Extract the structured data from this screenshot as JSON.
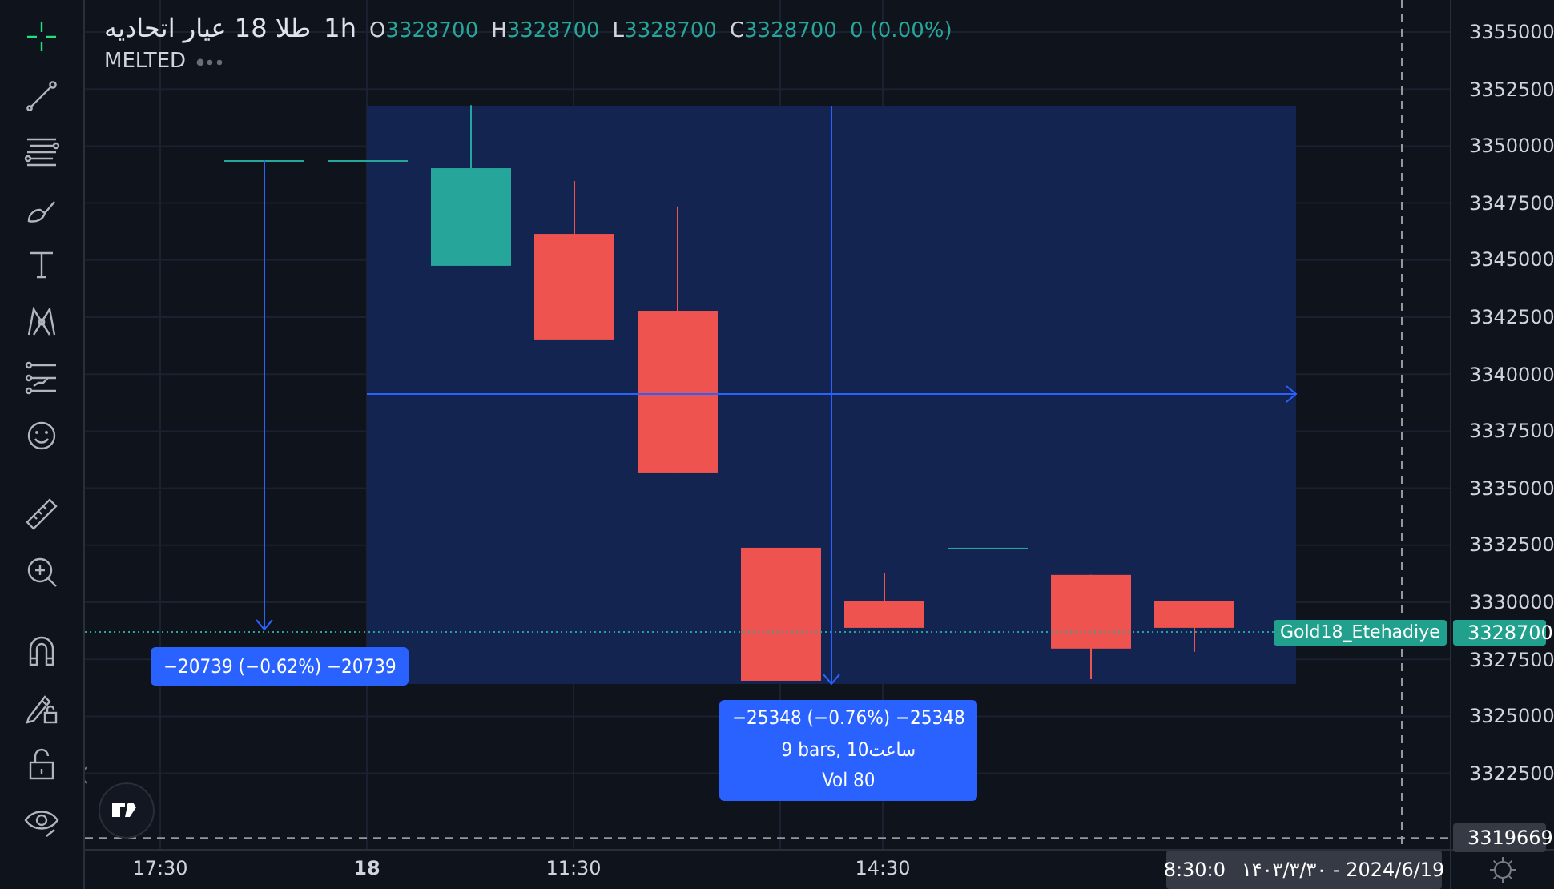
{
  "toolbar": {
    "tools": [
      {
        "kind": "crosshair",
        "selected": true
      },
      {
        "kind": "trend-line",
        "selected": false
      },
      {
        "kind": "fib-lines",
        "selected": false
      },
      {
        "kind": "brush",
        "selected": false
      },
      {
        "kind": "text",
        "selected": false
      },
      {
        "kind": "pattern",
        "selected": false
      },
      {
        "kind": "forecast",
        "selected": false
      },
      {
        "kind": "smiley",
        "selected": false
      },
      {
        "kind": "ruler",
        "selected": false
      },
      {
        "kind": "zoom-in",
        "selected": false
      },
      {
        "kind": "magnet",
        "selected": false
      },
      {
        "kind": "pencil-lock",
        "selected": false
      },
      {
        "kind": "lock",
        "selected": false
      },
      {
        "kind": "eye",
        "selected": false
      }
    ]
  },
  "legend": {
    "symbol": "طلا 18 عیار اتحادیه",
    "interval": "1h",
    "ohlc": [
      {
        "key": "O",
        "value": "3328700"
      },
      {
        "key": "H",
        "value": "3328700"
      },
      {
        "key": "L",
        "value": "3328700"
      },
      {
        "key": "C",
        "value": "3328700"
      }
    ],
    "change": "0 (0.00%)",
    "indicator": "MELTED"
  },
  "chart": {
    "measurements": [
      {
        "lines": [
          "−20739 (−0.62%) −20739"
        ]
      },
      {
        "lines": [
          "−25348 (−0.76%) −25348",
          "9 bars, 10ساعت",
          "Vol 80"
        ]
      }
    ],
    "last_price": {
      "name": "Gold18_Etehadiye",
      "price": "3328700"
    },
    "crosshair": {
      "price": "3319669",
      "time": "8:30:0",
      "date": "۱۴۰۳/۳/۳۰ - 2024/6/19"
    }
  },
  "price_axis": {
    "ticks": [
      "3355000",
      "3352500",
      "3350000",
      "3347500",
      "3345000",
      "3342500",
      "3340000",
      "3337500",
      "3335000",
      "3332500",
      "3330000",
      "3327500",
      "3325000",
      "3322500"
    ]
  },
  "time_axis": {
    "ticks": [
      {
        "label": "17:30",
        "bold": false
      },
      {
        "label": "18",
        "bold": true
      },
      {
        "label": "11:30",
        "bold": false
      },
      {
        "label": "14:30",
        "bold": false
      }
    ]
  }
}
